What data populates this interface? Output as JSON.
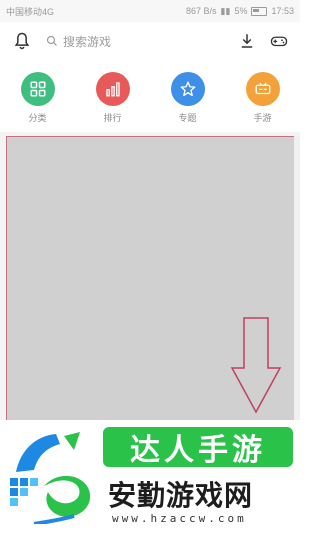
{
  "status_bar": {
    "carrier": "中国移动4G",
    "speed": "867 B/s",
    "battery": "5%",
    "time": "17:53"
  },
  "toolbar": {
    "search_placeholder": "搜索游戏"
  },
  "categories": [
    {
      "label": "分类",
      "color": "#3fbf7f",
      "icon": "grid-icon"
    },
    {
      "label": "排行",
      "color": "#e85a5a",
      "icon": "ranking-bars-icon"
    },
    {
      "label": "专题",
      "color": "#3d8fe8",
      "icon": "star-icon"
    },
    {
      "label": "手游",
      "color": "#f3a23b",
      "icon": "gamepad-icon"
    }
  ],
  "watermark": {
    "banner": "达人手游",
    "name": "安勤游戏网",
    "url": "www.hzaccw.com"
  },
  "colors": {
    "highlight_border": "#c07080",
    "content_gray": "#d0d0d0"
  }
}
